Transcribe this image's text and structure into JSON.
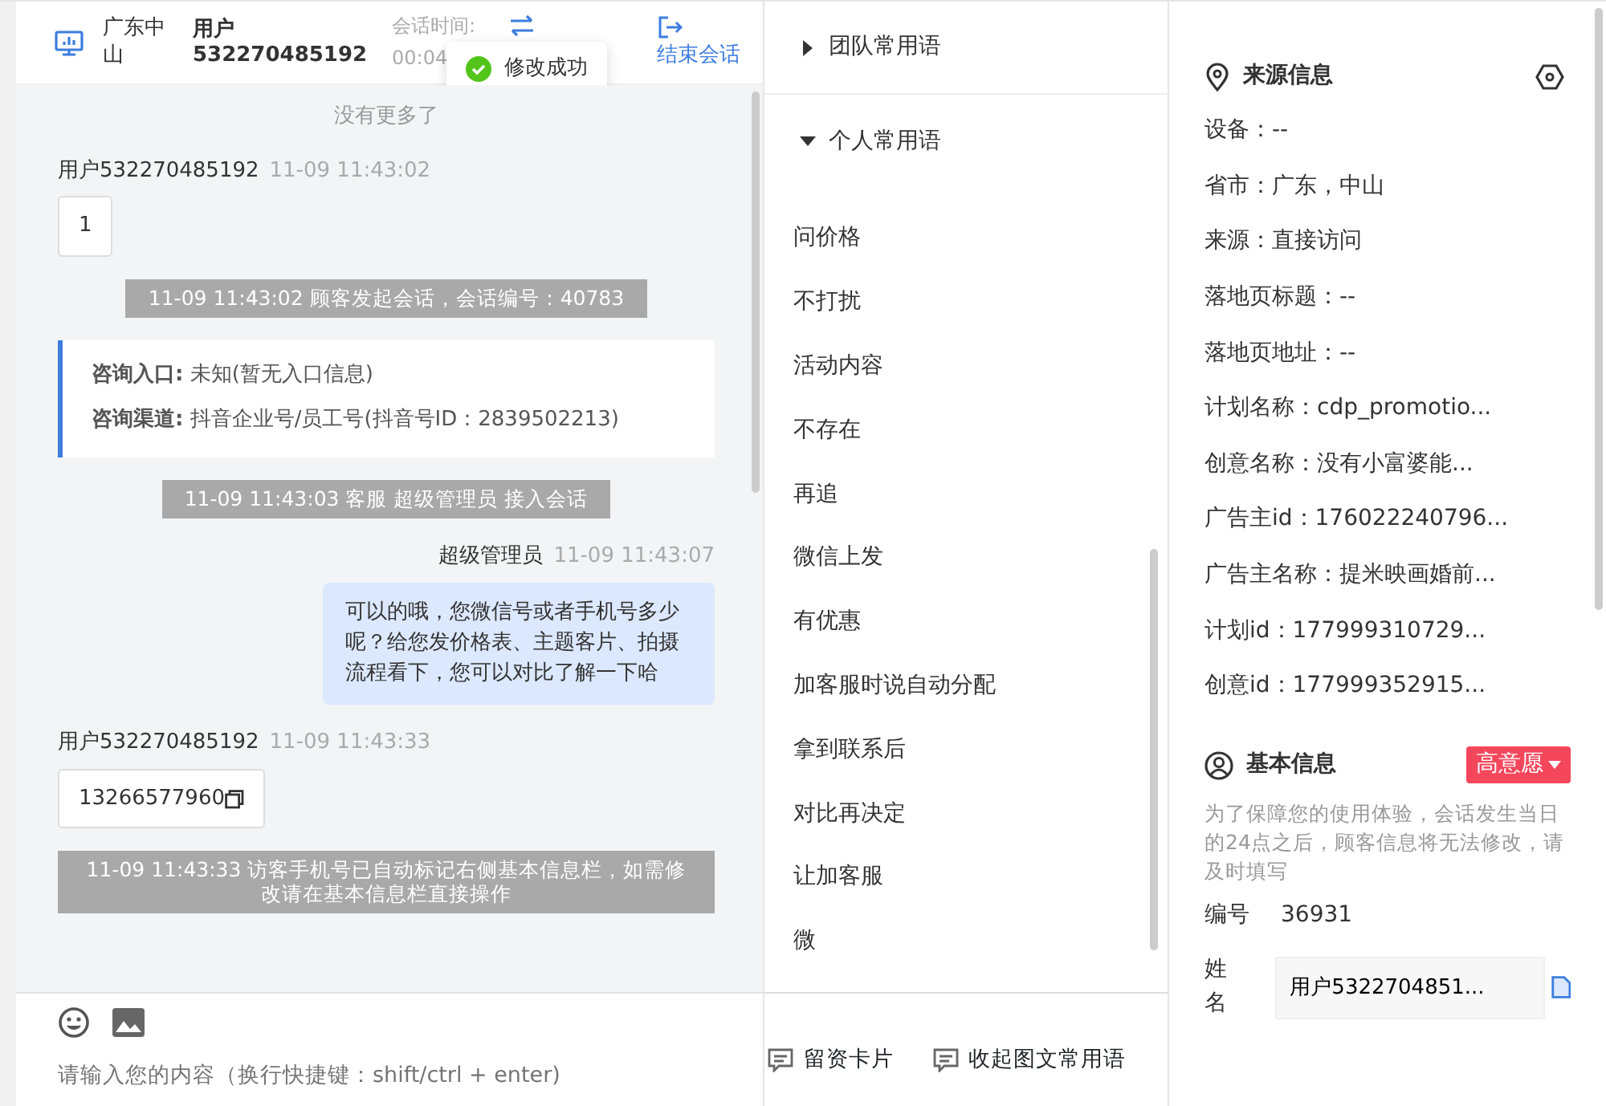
{
  "chat_header": {
    "location": "广东中山",
    "user": "用户532270485192",
    "time_label": "会话时间:",
    "time_value": "00:04",
    "end_label": "结束会话"
  },
  "toast": {
    "text": "修改成功"
  },
  "messages": [
    {
      "kind": "notice",
      "text": "没有更多了"
    },
    {
      "kind": "user",
      "sender": "用户532270485192",
      "time": "11-09 11:43:02",
      "text": "1"
    },
    {
      "kind": "system",
      "text": "11-09 11:43:02 顾客发起会话，会话编号：40783"
    },
    {
      "kind": "entry",
      "rows": [
        {
          "label": "咨询入口:",
          "value": "未知(暂无入口信息)"
        },
        {
          "label": "咨询渠道:",
          "value": "抖音企业号/员工号(抖音号ID：2839502213)"
        }
      ]
    },
    {
      "kind": "system",
      "text": "11-09 11:43:03 客服 超级管理员 接入会话"
    },
    {
      "kind": "agent",
      "sender": "超级管理员",
      "time": "11-09 11:43:07",
      "text": "可以的哦，您微信号或者手机号多少呢？给您发价格表、主题客片、拍摄流程看下，您可以对比了解一下哈"
    },
    {
      "kind": "user",
      "sender": "用户532270485192",
      "time": "11-09 11:43:33",
      "text": "13266577960",
      "copy": true
    },
    {
      "kind": "system",
      "text": "11-09 11:43:33 访客手机号已自动标记右侧基本信息栏，如需修改请在基本信息栏直接操作"
    }
  ],
  "composer": {
    "placeholder": "请输入您的内容（换行快捷键：shift/ctrl + enter)",
    "actions": [
      "留资卡片",
      "收起图文常用语"
    ]
  },
  "phrase_groups": [
    {
      "title": "团队常用语",
      "expanded": false
    },
    {
      "title": "个人常用语",
      "expanded": true,
      "items": [
        "问价格",
        "不打扰",
        "活动内容",
        "不存在",
        "再追",
        "微信上发",
        "有优惠",
        "加客服时说自动分配",
        "拿到联系后",
        "对比再决定",
        "让加客服",
        "微"
      ]
    }
  ],
  "source_info": {
    "title": "来源信息",
    "rows": [
      "设备：--",
      "省市：广东，中山",
      "来源：直接访问",
      "落地页标题：--",
      "落地页地址：--",
      "计划名称：cdp_promotio...",
      "创意名称：没有小富婆能...",
      "广告主id：176022240796...",
      "广告主名称：提米映画婚前...",
      "计划id：177999310729...",
      "创意id：177999352915..."
    ]
  },
  "basic_info": {
    "title": "基本信息",
    "tag": "高意愿",
    "hint": "为了保障您的使用体验，会话发生当日的24点之后，顾客信息将无法修改，请及时填写",
    "fields": [
      {
        "kind": "text",
        "label": "编号",
        "value": "36931"
      },
      {
        "kind": "input",
        "label": "姓名",
        "value": "用户5322704851..."
      }
    ]
  }
}
